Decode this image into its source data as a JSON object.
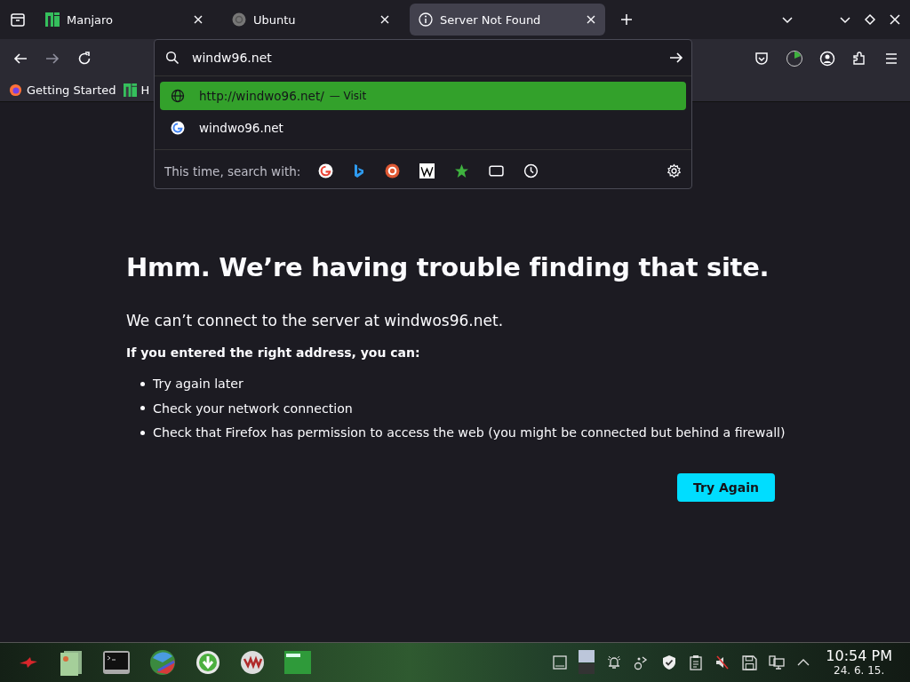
{
  "tabs": [
    {
      "label": "Manjaro",
      "selected": false,
      "kind": "manjaro"
    },
    {
      "label": "Ubuntu",
      "selected": false,
      "kind": "ubuntu"
    },
    {
      "label": "Server Not Found",
      "selected": true,
      "kind": "info"
    }
  ],
  "address_bar": {
    "value": "windw96.net"
  },
  "suggestions": [
    {
      "kind": "url",
      "text": "http://windwo96.net/",
      "action": "— Visit",
      "selected": true
    },
    {
      "kind": "search",
      "text": "windwo96.net",
      "selected": false
    }
  ],
  "search_with": {
    "label": "This time, search with:"
  },
  "bookmarks": [
    {
      "label": "Getting Started",
      "kind": "firefox"
    },
    {
      "label": "H",
      "kind": "manjaro"
    }
  ],
  "error_page": {
    "title": "Hmm. We’re having trouble finding that site.",
    "description": "We can’t connect to the server at windwos96.net.",
    "hint": "If you entered the right address, you can:",
    "items": [
      "Try again later",
      "Check your network connection",
      "Check that Firefox has permission to access the web (you might be connected but behind a firewall)"
    ],
    "button": "Try Again"
  },
  "taskbar": {
    "time": "10:54 PM",
    "date": "24. 6. 15."
  }
}
